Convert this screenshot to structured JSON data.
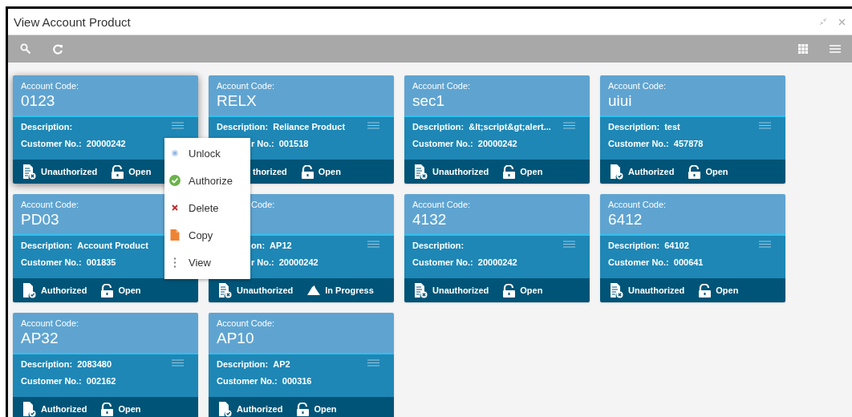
{
  "window": {
    "title": "View Account Product"
  },
  "cards": [
    {
      "code_label": "Account Code:",
      "code": "0123",
      "description_label": "Description:",
      "customer_label": "Customer No.:",
      "customer_no": "20000242",
      "status": {
        "text": "Unauthorized",
        "kind": "unauthorized"
      },
      "lock": {
        "text": "Open",
        "kind": "open"
      },
      "raised": true
    },
    {
      "code_label": "Account Code:",
      "code": "RELX",
      "description_label": "Description:",
      "description": "Reliance Product",
      "customer_label": "r No.:",
      "customer_no": "001518",
      "status": {
        "text": "thorized",
        "kind": "none"
      },
      "lock": {
        "text": "Open",
        "kind": "open"
      },
      "cut_customer": true,
      "cut_footer": true
    },
    {
      "code_label": "Account Code:",
      "code": "sec1",
      "description_label": "Description:",
      "description": "&lt;script&gt;alert...",
      "customer_label": "Customer No.:",
      "customer_no": "20000242",
      "status": {
        "text": "Unauthorized",
        "kind": "unauthorized"
      },
      "lock": {
        "text": "Open",
        "kind": "open"
      }
    },
    {
      "code_label": "Account Code:",
      "code": "uiui",
      "description_label": "Description:",
      "description": "test",
      "customer_label": "Customer No.:",
      "customer_no": "457878",
      "status": {
        "text": "Authorized",
        "kind": "authorized"
      },
      "lock": {
        "text": "Open",
        "kind": "open"
      }
    },
    {
      "code_label": "Account Code:",
      "code": "PD03",
      "description_label": "Description:",
      "description": "Account Product",
      "customer_label": "Customer No.:",
      "customer_no": "001835",
      "status": {
        "text": "Authorized",
        "kind": "authorized"
      },
      "lock": {
        "text": "Open",
        "kind": "open"
      },
      "menu_icon_hidden": true
    },
    {
      "code_label": "Code:",
      "description_label": "on:",
      "description": "AP12",
      "customer_label": "r No.:",
      "customer_no": "20000242",
      "status": {
        "text": "Unauthorized",
        "kind": "unauthorized"
      },
      "lock": {
        "text": "In Progress",
        "kind": "in_progress"
      },
      "cut_label": true,
      "cut_description": true,
      "cut_customer": true
    },
    {
      "code_label": "Account Code:",
      "code": "4132",
      "description_label": "Description:",
      "customer_label": "Customer No.:",
      "customer_no": "20000242",
      "status": {
        "text": "Unauthorized",
        "kind": "unauthorized"
      },
      "lock": {
        "text": "Open",
        "kind": "open"
      }
    },
    {
      "code_label": "Account Code:",
      "code": "6412",
      "description_label": "Description:",
      "description": "64102",
      "customer_label": "Customer No.:",
      "customer_no": "000641",
      "status": {
        "text": "Unauthorized",
        "kind": "unauthorized"
      },
      "lock": {
        "text": "Open",
        "kind": "open"
      }
    },
    {
      "code_label": "Account Code:",
      "code": "AP32",
      "description_label": "Description:",
      "description": "2083480",
      "customer_label": "Customer No.:",
      "customer_no": "002162",
      "status": {
        "text": "Authorized",
        "kind": "authorized"
      },
      "lock": {
        "text": "Open",
        "kind": "open"
      }
    },
    {
      "code_label": "Account Code:",
      "code": "AP10",
      "description_label": "Description:",
      "description": "AP2",
      "customer_label": "Customer No.:",
      "customer_no": "000316",
      "status": {
        "text": "Authorized",
        "kind": "authorized"
      },
      "lock": {
        "text": "Open",
        "kind": "open"
      }
    }
  ],
  "context_menu": [
    {
      "label": "Unlock",
      "kind": "unlock"
    },
    {
      "label": "Authorize",
      "kind": "authorize"
    },
    {
      "label": "Delete",
      "kind": "delete"
    },
    {
      "label": "Copy",
      "kind": "copy"
    },
    {
      "label": "View",
      "kind": "view"
    }
  ]
}
